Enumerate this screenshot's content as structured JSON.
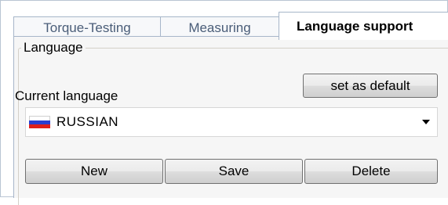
{
  "tabs": [
    {
      "label": "Torque-Testing"
    },
    {
      "label": "Measuring"
    },
    {
      "label": "Language support"
    }
  ],
  "language_group": {
    "title": "Language",
    "current_label": "Current language",
    "set_default_label": "set as default",
    "selected_language": "RUSSIAN",
    "flag_icon": "russia-flag-icon",
    "flag_colors": [
      "#ffffff",
      "#2a3fd1",
      "#e0201a"
    ]
  },
  "actions": {
    "new_label": "New",
    "save_label": "Save",
    "delete_label": "Delete"
  }
}
